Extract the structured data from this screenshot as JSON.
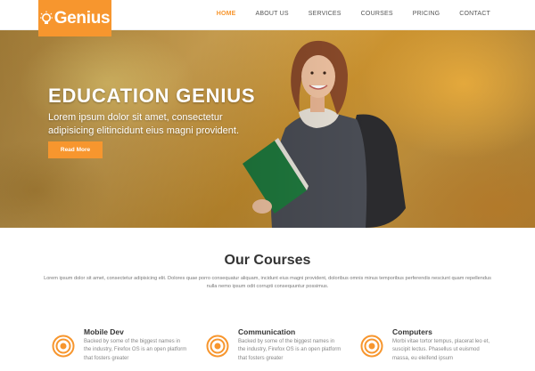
{
  "brand": {
    "name": "Genius",
    "accent_color": "#f7962e",
    "logo_icon": "lightbulb-icon"
  },
  "nav": {
    "items": [
      {
        "label": "HOME",
        "active": true
      },
      {
        "label": "ABOUT US",
        "active": false
      },
      {
        "label": "SERVICES",
        "active": false
      },
      {
        "label": "COURSES",
        "active": false
      },
      {
        "label": "PRICING",
        "active": false
      },
      {
        "label": "CONTACT",
        "active": false
      }
    ]
  },
  "hero": {
    "title": "EDUCATION GENIUS",
    "subtitle": "Lorem ipsum dolor sit amet, consectetur adipisicing elitincidunt eius magni provident.",
    "button_label": "Read More"
  },
  "courses": {
    "title": "Our Courses",
    "description": "Lorem ipsum dolor sit amet, consectetur adipisicing elit. Dolores quae porro consequatur aliquam, incidunt eius magni provident, doloribus omnis minus temporibus perferendis nesciunt quam repellendus nulla nemo ipsum odit corrupti consequuntur possimus.",
    "items": [
      {
        "title": "Mobile Dev",
        "text": "Backed by some of the biggest names in the industry, Firefox OS is an open platform that fosters greater",
        "icon": "target-icon"
      },
      {
        "title": "Communication",
        "text": "Backed by some of the biggest names in the industry, Firefox OS is an open platform that fosters greater",
        "icon": "target-icon"
      },
      {
        "title": "Computers",
        "text": "Morbi vitae tortor tempus, placerat leo et, suscipit lectus. Phasellus ut euismod massa, eu eleifend ipsum",
        "icon": "target-icon"
      }
    ]
  }
}
